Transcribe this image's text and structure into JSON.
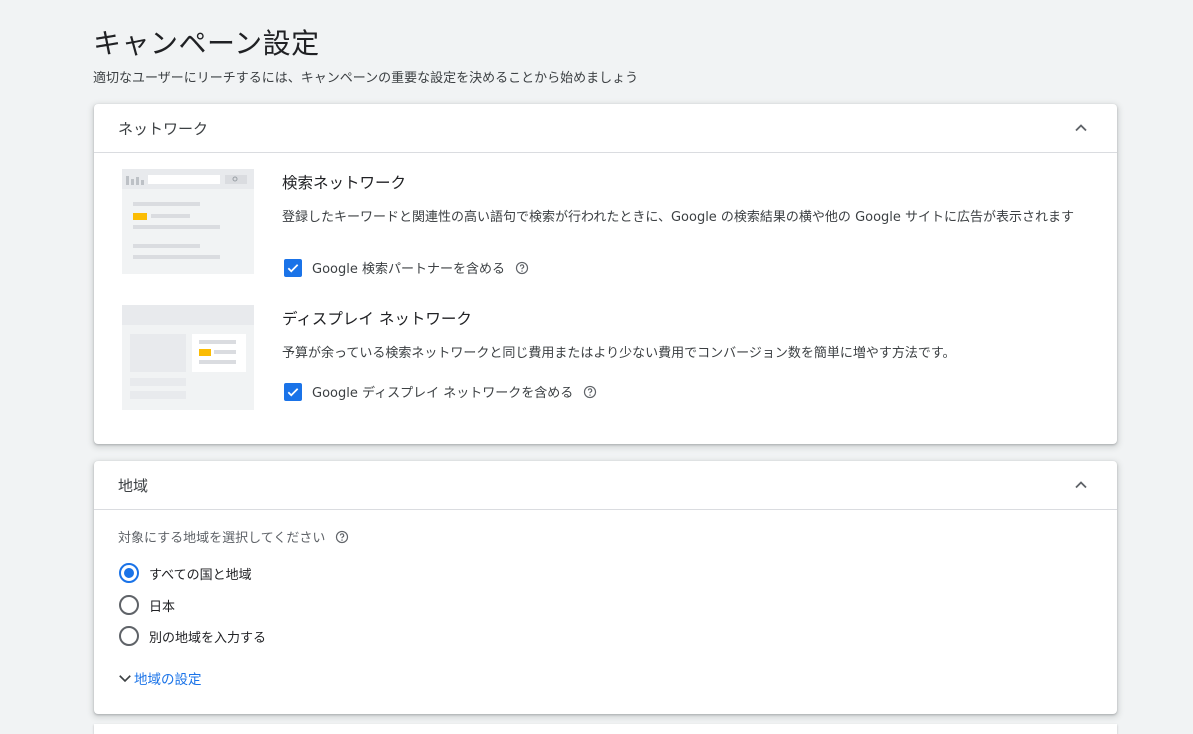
{
  "page": {
    "title": "キャンペーン設定",
    "subtitle": "適切なユーザーにリーチするには、キャンペーンの重要な設定を決めることから始めましょう"
  },
  "network": {
    "header": "ネットワーク",
    "search": {
      "title": "検索ネットワーク",
      "description": "登録したキーワードと関連性の高い語句で検索が行われたときに、Google の検索結果の横や他の Google サイトに広告が表示されます",
      "checkbox_label": "Google 検索パートナーを含める",
      "checked": true
    },
    "display": {
      "title": "ディスプレイ ネットワーク",
      "description": "予算が余っている検索ネットワークと同じ費用またはより少ない費用でコンバージョン数を簡単に増やす方法です。",
      "checkbox_label": "Google ディスプレイ ネットワークを含める",
      "checked": true
    }
  },
  "location": {
    "header": "地域",
    "prompt": "対象にする地域を選択してください",
    "options": [
      "すべての国と地域",
      "日本",
      "別の地域を入力する"
    ],
    "selected_index": 0,
    "settings_link": "地域の設定"
  },
  "colors": {
    "accent": "#1a73e8",
    "highlight": "#fbbc04",
    "background": "#f1f3f4"
  },
  "icons": {
    "collapse": "chevron-up-icon",
    "help": "help-circle-icon",
    "expand": "chevron-down-icon",
    "check": "check-icon"
  }
}
